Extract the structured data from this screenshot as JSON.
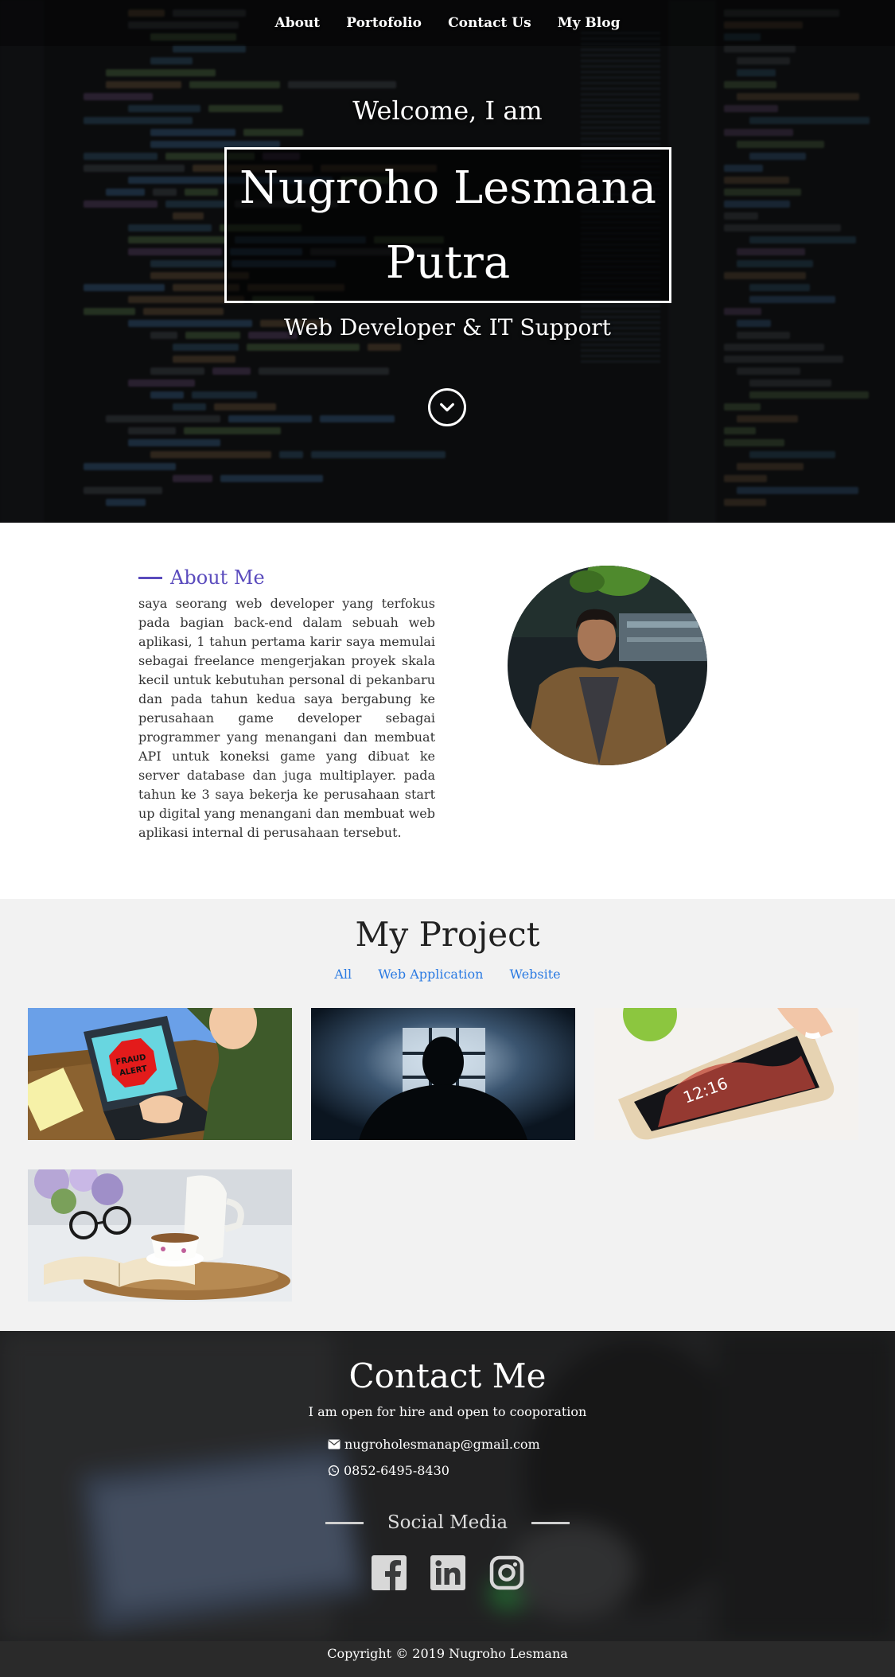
{
  "nav": {
    "items": [
      "About",
      "Portofolio",
      "Contact Us",
      "My Blog"
    ]
  },
  "hero": {
    "welcome": "Welcome, I am",
    "name": "Nugroho Lesmana Putra",
    "role": "Web Developer & IT Support",
    "scroll_icon": "chevron-down-circle-icon"
  },
  "about": {
    "title": "About Me",
    "text": "saya seorang web developer yang terfokus pada bagian back-end dalam sebuah web aplikasi, 1 tahun pertama karir saya memulai sebagai freelance mengerjakan proyek skala kecil untuk kebutuhan personal di pekanbaru dan pada tahun kedua saya bergabung ke perusahaan game developer sebagai programmer yang menangani dan membuat API untuk koneksi game yang dibuat ke server database dan juga multiplayer. pada tahun ke 3 saya bekerja ke perusahaan start up digital yang menangani dan membuat web aplikasi internal di perusahaan tersebut.",
    "accent_color": "#5a4bbd"
  },
  "projects": {
    "title": "My Project",
    "filters": [
      "All",
      "Web Application",
      "Website"
    ],
    "items": [
      "fraud-alert-laptop",
      "silhouette-window",
      "hand-smartphone",
      "book-glasses-tea"
    ]
  },
  "contact": {
    "title": "Contact Me",
    "lead": "I am open for hire and open to cooporation",
    "email": "nugroholesmanap@gmail.com",
    "phone": "0852-6495-8430",
    "social_title": "Social Media",
    "social": [
      "facebook-icon",
      "linkedin-icon",
      "instagram-icon"
    ]
  },
  "footer": {
    "copyright": "Copyright © 2019 Nugroho Lesmana"
  }
}
